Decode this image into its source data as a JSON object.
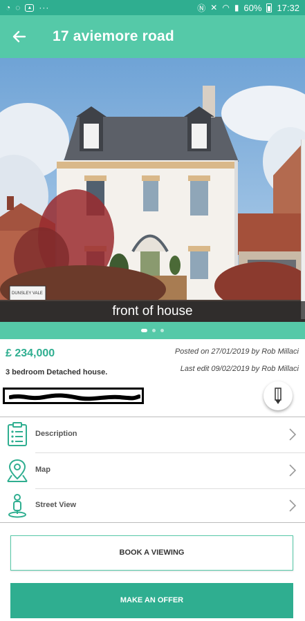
{
  "status_bar": {
    "notification_icons": [
      "messenger-icon",
      "whatsapp-icon",
      "gallery-icon"
    ],
    "more": "···",
    "battery": "60%",
    "time": "17:32"
  },
  "app_bar": {
    "title": "17 aviemore road"
  },
  "gallery": {
    "caption": "front of house",
    "page_count": 3,
    "active_index": 0
  },
  "property": {
    "price": "£ 234,000",
    "description": "3 bedroom Detached house.",
    "posted": "Posted on 27/01/2019 by Rob Millaci",
    "last_edit": "Last edit 09/02/2019 by Rob Millaci"
  },
  "menu": [
    {
      "label": "Description",
      "icon": "document-icon"
    },
    {
      "label": "Map",
      "icon": "map-pin-icon"
    },
    {
      "label": "Street View",
      "icon": "pegman-icon"
    }
  ],
  "actions": {
    "book_viewing": "BOOK A VIEWING",
    "make_offer": "MAKE AN OFFER"
  },
  "colors": {
    "status_bar": "#2fae90",
    "app_bar": "#55c9a8",
    "accent": "#2fae90"
  }
}
